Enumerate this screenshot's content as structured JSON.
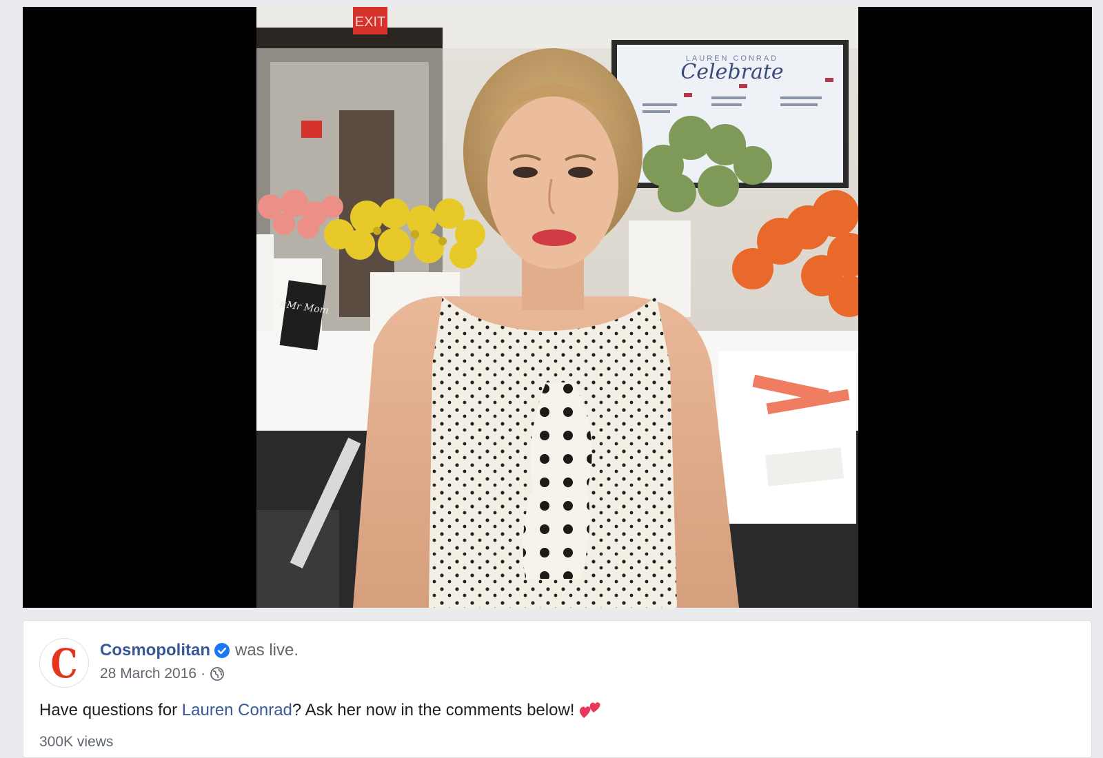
{
  "post": {
    "page_name": "Cosmopolitan",
    "action": "was live.",
    "date": "28 March 2016",
    "separator": "·",
    "avatar_letter": "C",
    "text_before": "Have questions for ",
    "mention": "Lauren Conrad",
    "text_after": "? Ask her now in the comments below!",
    "emoji": "two-hearts-emoji",
    "views_partial": "300K views"
  },
  "video": {
    "screen_title_small": "LAUREN CONRAD",
    "screen_title_script": "Celebrate",
    "exit_sign": "EXIT",
    "chalkboard_text": "#Mr Mom"
  },
  "colors": {
    "page_background": "#e9ebee",
    "link_blue": "#385898",
    "verified_blue": "#1877f2",
    "brand_red": "#e5351f",
    "meta_gray": "#606770"
  },
  "icons": {
    "verified": "verified-badge-icon",
    "privacy": "globe-icon"
  }
}
